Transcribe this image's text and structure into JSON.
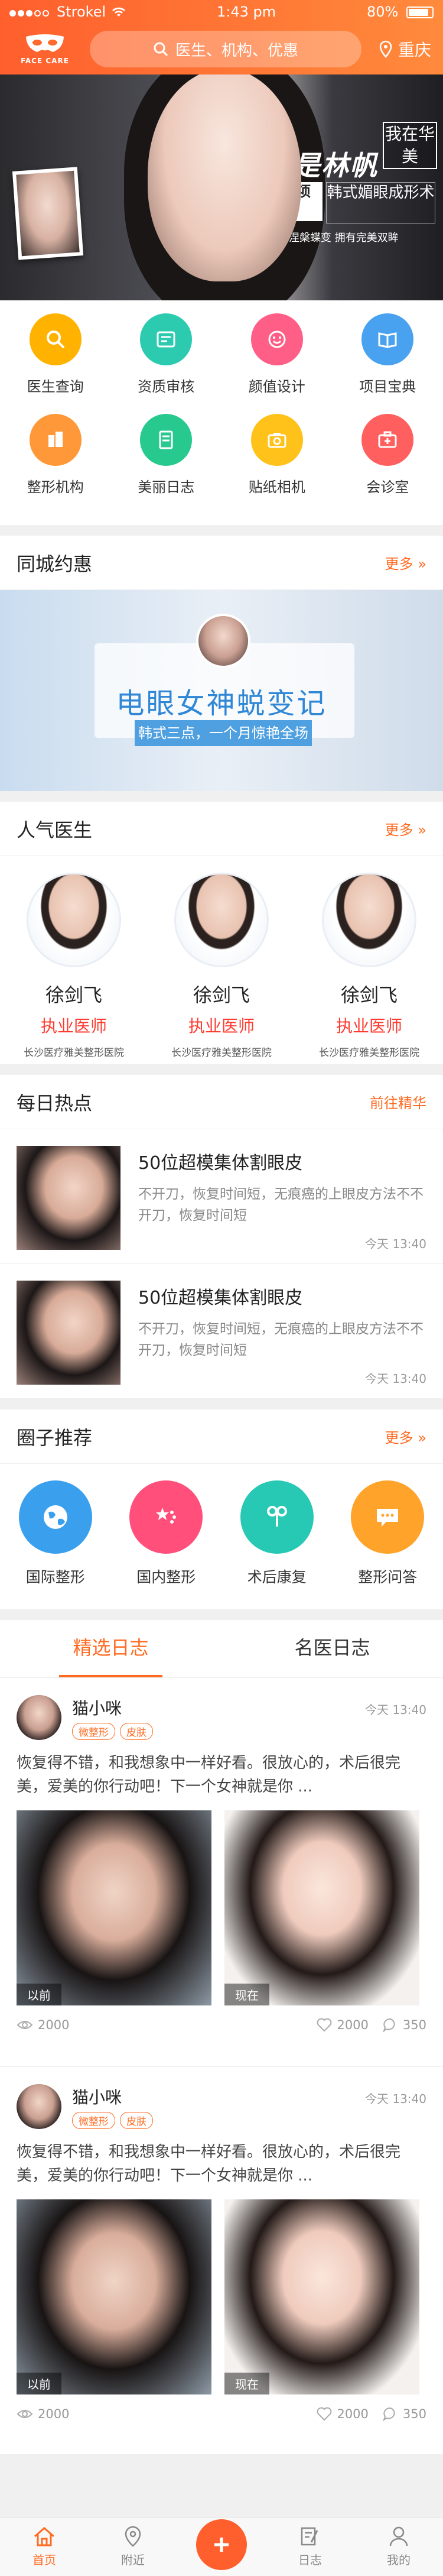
{
  "status": {
    "carrier": "Strokel",
    "time": "1:43 pm",
    "battery": "80%"
  },
  "header": {
    "logo_text": "FACE CARE",
    "search_placeholder": "医生、机构、优惠",
    "city": "重庆"
  },
  "banner": {
    "title": "我是林帆",
    "tag": "我在华美",
    "box": "整形项目",
    "subtitle": "韩式媚眼成形术",
    "caption": "20天涅槃蝶变  拥有完美双眸"
  },
  "grid": [
    {
      "label": "医生查询",
      "color": "#ffb300",
      "icon": "search-icon"
    },
    {
      "label": "资质审核",
      "color": "#2ccbb0",
      "icon": "certificate-icon"
    },
    {
      "label": "颜值设计",
      "color": "#ff5f86",
      "icon": "face-icon"
    },
    {
      "label": "项目宝典",
      "color": "#48a2f0",
      "icon": "book-icon"
    },
    {
      "label": "整形机构",
      "color": "#ff9838",
      "icon": "building-icon"
    },
    {
      "label": "美丽日志",
      "color": "#27c98f",
      "icon": "diary-icon"
    },
    {
      "label": "贴纸相机",
      "color": "#ffc21a",
      "icon": "camera-icon"
    },
    {
      "label": "会诊室",
      "color": "#ff5f5f",
      "icon": "clinic-icon"
    }
  ],
  "deals": {
    "title": "同城约惠",
    "more": "更多",
    "banner_title": "电眼女神蜕变记",
    "banner_sub": "韩式三点，一个月惊艳全场"
  },
  "doctors": {
    "title": "人气医生",
    "more": "更多",
    "items": [
      {
        "name": "徐剑飞",
        "title": "执业医师",
        "hospital": "长沙医疗雅美整形医院"
      },
      {
        "name": "徐剑飞",
        "title": "执业医师",
        "hospital": "长沙医疗雅美整形医院"
      },
      {
        "name": "徐剑飞",
        "title": "执业医师",
        "hospital": "长沙医疗雅美整形医院"
      }
    ]
  },
  "hot": {
    "title": "每日热点",
    "more": "前往精华",
    "items": [
      {
        "title": "50位超模集体割眼皮",
        "desc": "不开刀，恢复时间短，无痕癌的上眼皮方法不不开刀，恢复时间短",
        "time": "今天 13:40"
      },
      {
        "title": "50位超模集体割眼皮",
        "desc": "不开刀，恢复时间短，无痕癌的上眼皮方法不不开刀，恢复时间短",
        "time": "今天 13:40"
      }
    ]
  },
  "circles": {
    "title": "圈子推荐",
    "more": "更多",
    "items": [
      {
        "label": "国际整形",
        "color": "#3aa0ee",
        "icon": "globe-icon"
      },
      {
        "label": "国内整形",
        "color": "#ff4f7a",
        "icon": "flag-icon"
      },
      {
        "label": "术后康复",
        "color": "#27c9b4",
        "icon": "recovery-icon"
      },
      {
        "label": "整形问答",
        "color": "#ffa32a",
        "icon": "chat-icon"
      }
    ]
  },
  "tabs": [
    "精选日志",
    "名医日志"
  ],
  "posts": [
    {
      "user": "猫小咪",
      "tags": [
        "微整形",
        "皮肤"
      ],
      "time": "今天 13:40",
      "text": "恢复得不错，和我想象中一样好看。很放心的，术后很完美，爱美的你行动吧！下一个女神就是你 ...",
      "before": "以前",
      "after": "现在",
      "views": "2000",
      "likes": "2000",
      "comments": "350"
    },
    {
      "user": "猫小咪",
      "tags": [
        "微整形",
        "皮肤"
      ],
      "time": "今天 13:40",
      "text": "恢复得不错，和我想象中一样好看。很放心的，术后很完美，爱美的你行动吧！下一个女神就是你 ...",
      "before": "以前",
      "after": "现在",
      "views": "2000",
      "likes": "2000",
      "comments": "350"
    }
  ],
  "tabbar": [
    {
      "label": "首页",
      "icon": "home-icon",
      "active": true
    },
    {
      "label": "附近",
      "icon": "location-icon",
      "active": false
    },
    {
      "label": "",
      "icon": "plus-icon",
      "active": false
    },
    {
      "label": "日志",
      "icon": "edit-icon",
      "active": false
    },
    {
      "label": "我的",
      "icon": "user-icon",
      "active": false
    }
  ]
}
